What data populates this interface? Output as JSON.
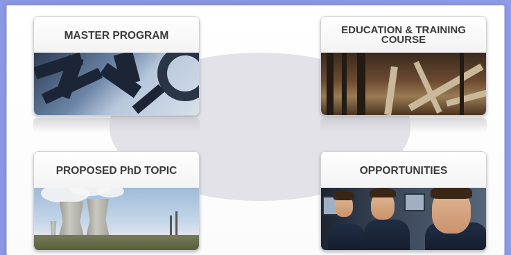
{
  "cards": {
    "master": {
      "title": "MASTER PROGRAM"
    },
    "education": {
      "title": "EDUCATION & TRAINING COURSE"
    },
    "phd": {
      "title": "PROPOSED PhD TOPIC"
    },
    "opportunities": {
      "title": "OPPORTUNITIES"
    }
  },
  "icons": {
    "master": "gear-photo",
    "education": "industrial-photo",
    "phd": "cooling-tower-photo",
    "opportunities": "crew-photo"
  },
  "colors": {
    "background": "#8c97e3",
    "card_title": "#3a3a3a",
    "ellipse": "#e2e2e8"
  }
}
